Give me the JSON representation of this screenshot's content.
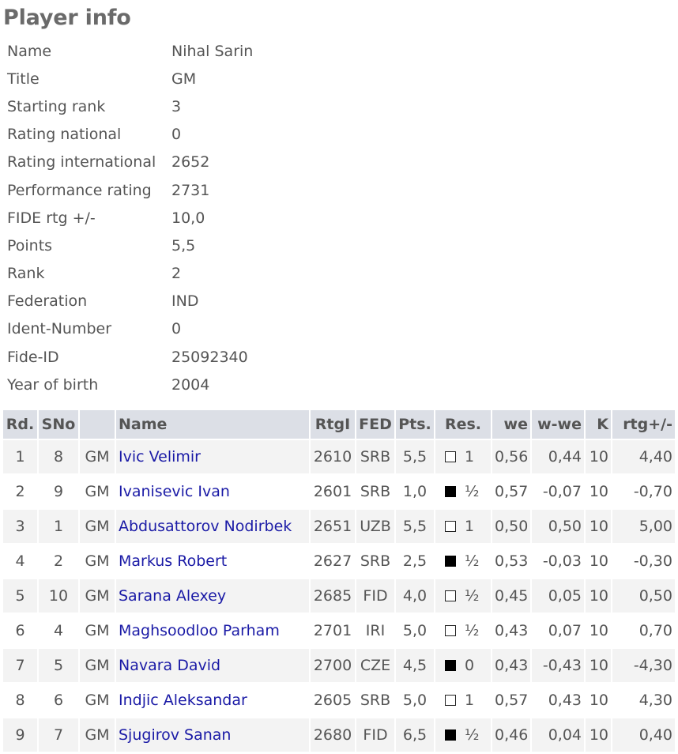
{
  "page_title": "Player info",
  "info": [
    {
      "label": "Name",
      "value": "Nihal Sarin"
    },
    {
      "label": "Title",
      "value": "GM"
    },
    {
      "label": "Starting rank",
      "value": "3"
    },
    {
      "label": "Rating national",
      "value": "0"
    },
    {
      "label": "Rating international",
      "value": "2652"
    },
    {
      "label": "Performance rating",
      "value": "2731"
    },
    {
      "label": "FIDE rtg +/-",
      "value": "10,0"
    },
    {
      "label": "Points",
      "value": "5,5"
    },
    {
      "label": "Rank",
      "value": "2"
    },
    {
      "label": "Federation",
      "value": "IND"
    },
    {
      "label": "Ident-Number",
      "value": "0"
    },
    {
      "label": "Fide-ID",
      "value": "25092340"
    },
    {
      "label": "Year of birth",
      "value": "2004"
    }
  ],
  "games": {
    "headers": {
      "rd": "Rd.",
      "sno": "SNo",
      "title": "",
      "name": "Name",
      "rtgi": "RtgI",
      "fed": "FED",
      "pts": "Pts.",
      "res": "Res.",
      "we": "we",
      "wwe": "w-we",
      "k": "K",
      "rtg": "rtg+/-"
    },
    "colors": {
      "white_piece": "#ffffff",
      "black_piece": "#000000",
      "link": "#1a1aa6",
      "header_bg": "#dcdfe6",
      "row_alt_bg": "#f3f3f3"
    },
    "rows": [
      {
        "rd": "1",
        "sno": "8",
        "title": "GM",
        "name": "Ivic Velimir",
        "rtgi": "2610",
        "fed": "SRB",
        "pts": "5,5",
        "color": "white",
        "res": "1",
        "we": "0,56",
        "wwe": "0,44",
        "k": "10",
        "rtg": "4,40"
      },
      {
        "rd": "2",
        "sno": "9",
        "title": "GM",
        "name": "Ivanisevic Ivan",
        "rtgi": "2601",
        "fed": "SRB",
        "pts": "1,0",
        "color": "black",
        "res": "½",
        "we": "0,57",
        "wwe": "-0,07",
        "k": "10",
        "rtg": "-0,70"
      },
      {
        "rd": "3",
        "sno": "1",
        "title": "GM",
        "name": "Abdusattorov Nodirbek",
        "rtgi": "2651",
        "fed": "UZB",
        "pts": "5,5",
        "color": "white",
        "res": "1",
        "we": "0,50",
        "wwe": "0,50",
        "k": "10",
        "rtg": "5,00"
      },
      {
        "rd": "4",
        "sno": "2",
        "title": "GM",
        "name": "Markus Robert",
        "rtgi": "2627",
        "fed": "SRB",
        "pts": "2,5",
        "color": "black",
        "res": "½",
        "we": "0,53",
        "wwe": "-0,03",
        "k": "10",
        "rtg": "-0,30"
      },
      {
        "rd": "5",
        "sno": "10",
        "title": "GM",
        "name": "Sarana Alexey",
        "rtgi": "2685",
        "fed": "FID",
        "pts": "4,0",
        "color": "white",
        "res": "½",
        "we": "0,45",
        "wwe": "0,05",
        "k": "10",
        "rtg": "0,50"
      },
      {
        "rd": "6",
        "sno": "4",
        "title": "GM",
        "name": "Maghsoodloo Parham",
        "rtgi": "2701",
        "fed": "IRI",
        "pts": "5,0",
        "color": "white",
        "res": "½",
        "we": "0,43",
        "wwe": "0,07",
        "k": "10",
        "rtg": "0,70"
      },
      {
        "rd": "7",
        "sno": "5",
        "title": "GM",
        "name": "Navara David",
        "rtgi": "2700",
        "fed": "CZE",
        "pts": "4,5",
        "color": "black",
        "res": "0",
        "we": "0,43",
        "wwe": "-0,43",
        "k": "10",
        "rtg": "-4,30"
      },
      {
        "rd": "8",
        "sno": "6",
        "title": "GM",
        "name": "Indjic Aleksandar",
        "rtgi": "2605",
        "fed": "SRB",
        "pts": "5,0",
        "color": "white",
        "res": "1",
        "we": "0,57",
        "wwe": "0,43",
        "k": "10",
        "rtg": "4,30"
      },
      {
        "rd": "9",
        "sno": "7",
        "title": "GM",
        "name": "Sjugirov Sanan",
        "rtgi": "2680",
        "fed": "FID",
        "pts": "6,5",
        "color": "black",
        "res": "½",
        "we": "0,46",
        "wwe": "0,04",
        "k": "10",
        "rtg": "0,40"
      }
    ]
  }
}
